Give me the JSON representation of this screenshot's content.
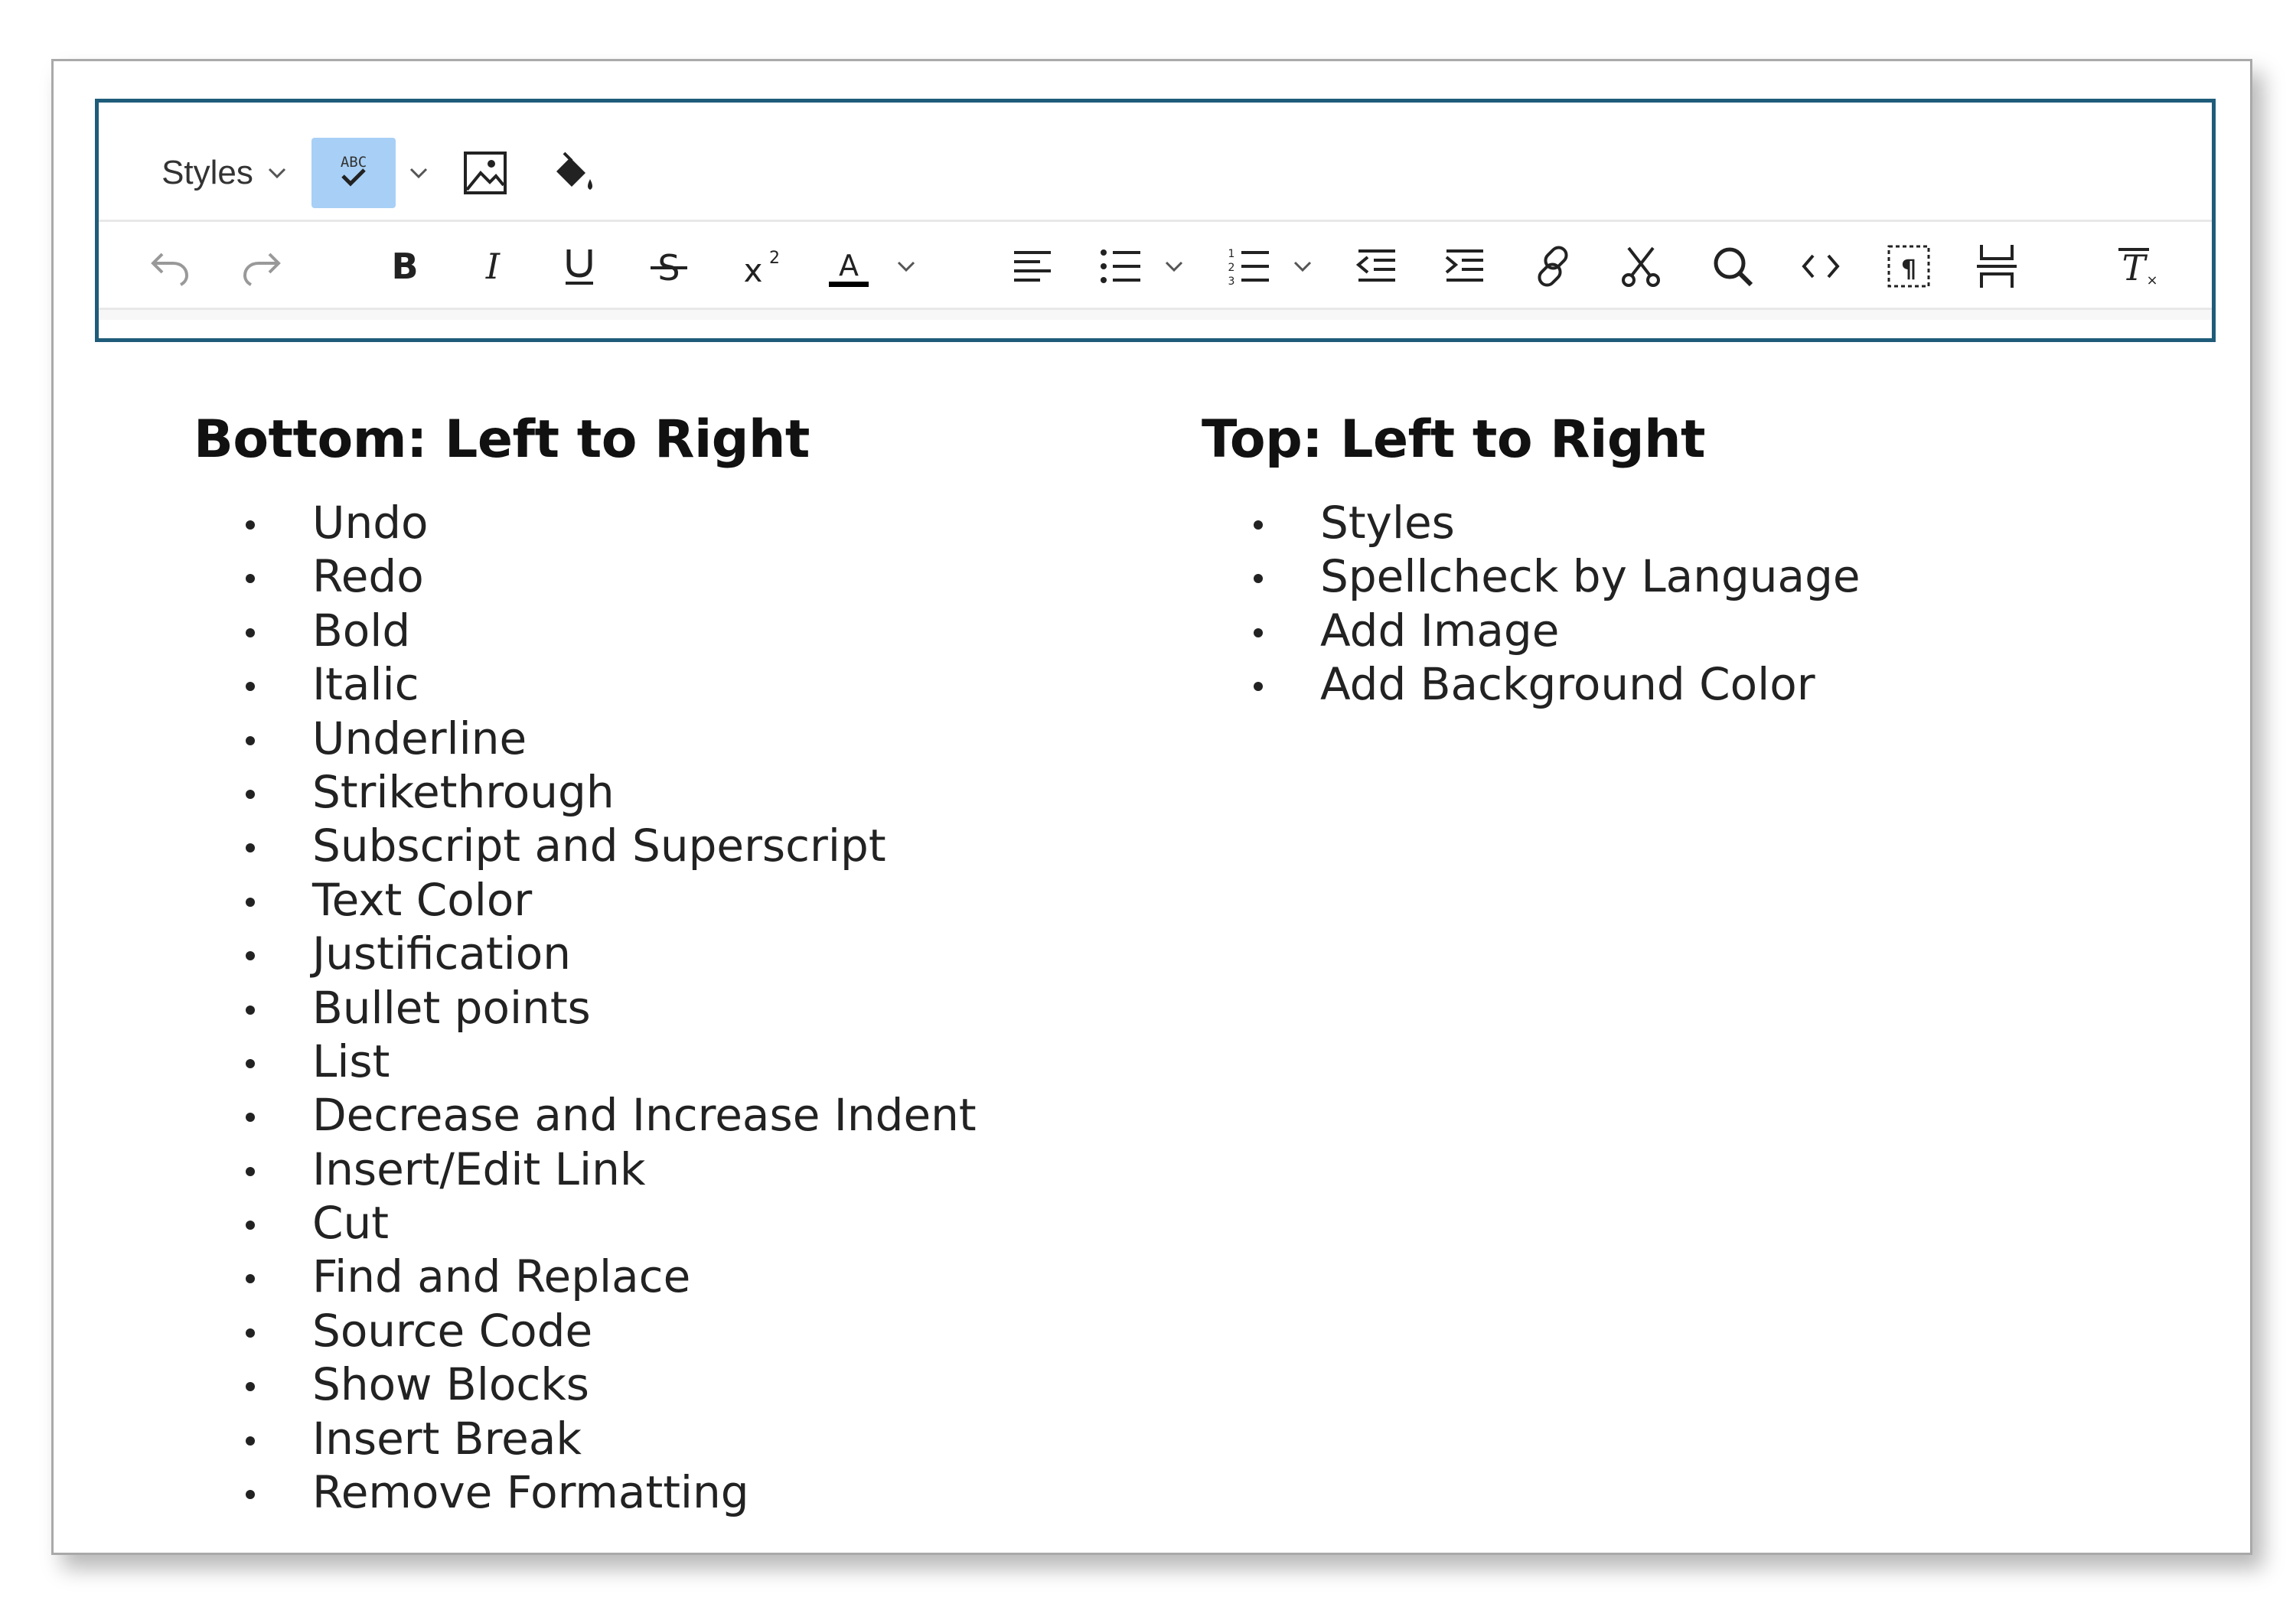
{
  "toolbar": {
    "styles_label": "Styles",
    "top_row": [
      {
        "name": "styles-dropdown",
        "icon": "chevron-down-icon"
      },
      {
        "name": "spellcheck-button",
        "icon": "spellcheck-abc-icon",
        "active": true
      },
      {
        "name": "add-image-button",
        "icon": "image-icon"
      },
      {
        "name": "background-color-button",
        "icon": "paint-bucket-icon"
      }
    ],
    "bottom_row": [
      "undo-icon",
      "redo-icon",
      "bold-icon",
      "italic-icon",
      "underline-icon",
      "strikethrough-icon",
      "superscript-icon",
      "text-color-icon",
      "align-left-icon",
      "bulleted-list-icon",
      "numbered-list-icon",
      "decrease-indent-icon",
      "increase-indent-icon",
      "link-icon",
      "cut-icon",
      "search-icon",
      "source-code-icon",
      "show-blocks-icon",
      "insert-break-icon",
      "remove-format-icon"
    ],
    "active_color": "#a8d0f6",
    "border_color": "#1f5c7a"
  },
  "bottom_section": {
    "title": "Bottom: Left to Right",
    "items": [
      "Undo",
      "Redo",
      "Bold",
      "Italic",
      "Underline",
      "Strikethrough",
      "Subscript and Superscript",
      "Text Color",
      "Justification",
      "Bullet points",
      "List",
      "Decrease and Increase Indent",
      "Insert/Edit Link",
      "Cut",
      "Find and Replace",
      "Source Code",
      "Show Blocks",
      "Insert Break",
      "Remove Formatting"
    ]
  },
  "top_section": {
    "title": "Top: Left to Right",
    "items": [
      "Styles",
      "Spellcheck by Language",
      "Add Image",
      "Add Background Color"
    ]
  }
}
